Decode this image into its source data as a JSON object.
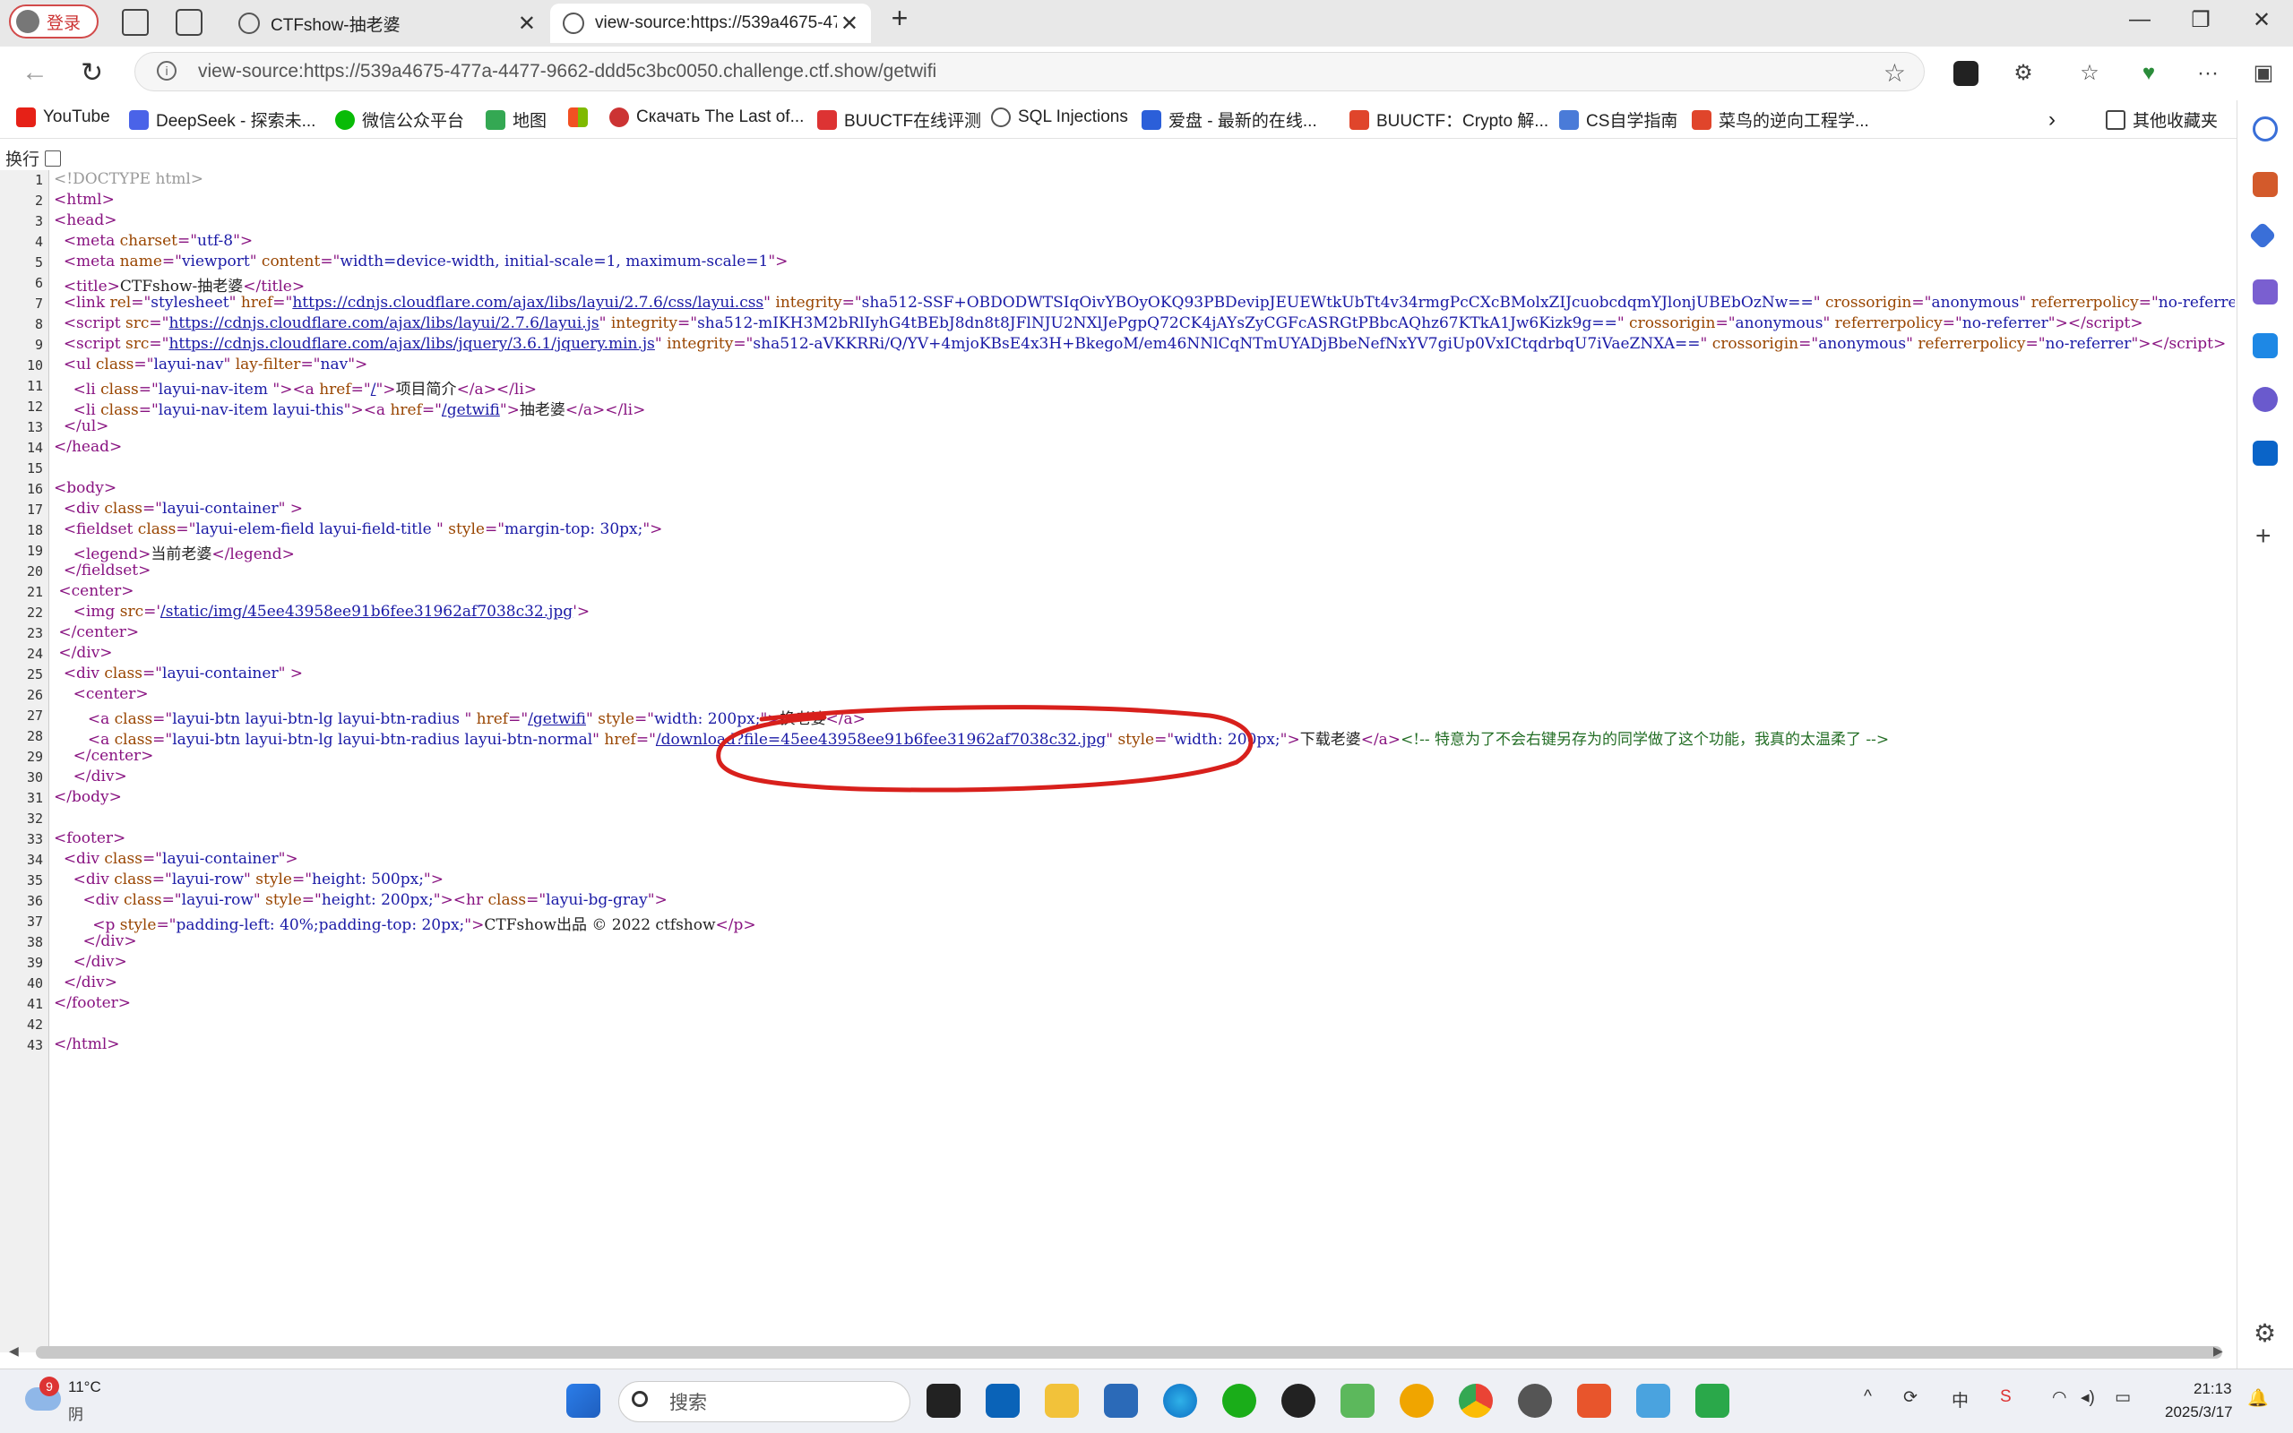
{
  "browser": {
    "profile_label": "登录",
    "tabs": [
      {
        "title": "CTFshow-抽老婆",
        "active": false
      },
      {
        "title": "view-source:https://539a4675-47",
        "active": true
      }
    ],
    "new_tab": "+",
    "window_controls": {
      "minimize": "—",
      "restore": "❐",
      "close": "✕"
    },
    "url": "view-source:https://539a4675-477a-4477-9662-ddd5c3bc0050.challenge.ctf.show/getwifi",
    "more": "···"
  },
  "bookmarks": [
    {
      "label": "YouTube",
      "color": "#e62117"
    },
    {
      "label": "DeepSeek - 探索未...",
      "color": "#4a63e8"
    },
    {
      "label": "微信公众平台",
      "color": "#09bb07"
    },
    {
      "label": "地图",
      "color": "#34a853"
    },
    {
      "label": "",
      "color": "#f25022"
    },
    {
      "label": "Скачать The Last of...",
      "color": "#c33"
    },
    {
      "label": "BUUCTF在线评测",
      "color": "#d33"
    },
    {
      "label": "SQL Injections",
      "color": "#555"
    },
    {
      "label": "爱盘 - 最新的在线...",
      "color": "#2b5fd9"
    },
    {
      "label": "BUUCTF：Crypto 解...",
      "color": "#e0452b"
    },
    {
      "label": "CS自学指南",
      "color": "#4a7bd8"
    },
    {
      "label": "菜鸟的逆向工程学...",
      "color": "#e0452b"
    }
  ],
  "bookmarks_more": "其他收藏夹",
  "wrap_label": "换行",
  "source": {
    "doctype": "<!DOCTYPE html>",
    "title_text": "CTFshow-抽老婆",
    "css_href": "https://cdnjs.cloudflare.com/ajax/libs/layui/2.7.6/css/layui.css",
    "css_integrity": "sha512-SSF+OBDODWTSIqOivYBOyOKQ93PBDevipJEUEWtkUbTt4v34rmgPcCXcBMolxZIJcuobcdqmYJlonjUBEbOzNw==",
    "js1_src": "https://cdnjs.cloudflare.com/ajax/libs/layui/2.7.6/layui.js",
    "js1_integrity": "sha512-mIKH3M2bRlIyhG4tBEbJ8dn8t8JFlNJU2NXlJePgpQ72CK4jAYsZyCGFcASRGtPBbcAQhz67KTkA1Jw6Kizk9g==",
    "js2_src": "https://cdnjs.cloudflare.com/ajax/libs/jquery/3.6.1/jquery.min.js",
    "js2_integrity": "sha512-aVKKRRi/Q/YV+4mjoKBsE4x3H+BkegoM/em46NNlCqNTmUYADjBbeNefNxYV7giUp0VxICtqdrbqU7iVaeZNXA==",
    "nav1": "项目简介",
    "nav2": "抽老婆",
    "legend": "当前老婆",
    "img_src": "/static/img/45ee43958ee91b6fee31962af7038c32.jpg",
    "btn1_href": "/getwifi",
    "btn1_text": "换老婆",
    "btn2_href": "/download?file=45ee43958ee91b6fee31962af7038c32.jpg",
    "btn2_text": "下载老婆",
    "comment": "<!-- 特意为了不会右键另存为的同学做了这个功能，我真的太温柔了 -->",
    "footer_text": "CTFshow出品 © 2022 ctfshow"
  },
  "taskbar": {
    "weather_badge": "9",
    "temperature": "11°C",
    "condition": "阴",
    "search_placeholder": "搜索",
    "tray_ime": "中",
    "time": "21:13",
    "date": "2025/3/17"
  }
}
